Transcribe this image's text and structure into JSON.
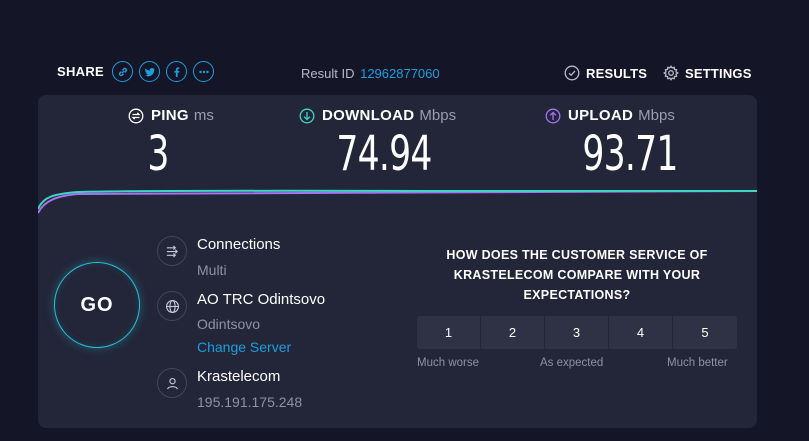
{
  "share": {
    "label": "SHARE",
    "buttons": [
      "link-icon",
      "twitter-icon",
      "facebook-icon",
      "more-icon"
    ]
  },
  "result": {
    "label": "Result ID",
    "id": "12962877060"
  },
  "nav": {
    "results": "RESULTS",
    "settings": "SETTINGS"
  },
  "metrics": {
    "ping": {
      "name": "PING",
      "unit": "ms",
      "value": "3"
    },
    "download": {
      "name": "DOWNLOAD",
      "unit": "Mbps",
      "value": "74.94"
    },
    "upload": {
      "name": "UPLOAD",
      "unit": "Mbps",
      "value": "93.71"
    }
  },
  "go_label": "GO",
  "connections": {
    "title": "Connections",
    "value": "Multi"
  },
  "server": {
    "name": "AO TRC Odintsovo",
    "location": "Odintsovo",
    "change": "Change Server"
  },
  "provider": {
    "name": "Krastelecom",
    "ip": "195.191.175.248"
  },
  "survey": {
    "question": "HOW DOES THE CUSTOMER SERVICE OF KRASTELECOM COMPARE WITH YOUR EXPECTATIONS?",
    "options": [
      "1",
      "2",
      "3",
      "4",
      "5"
    ],
    "low": "Much worse",
    "mid": "As expected",
    "high": "Much better"
  },
  "colors": {
    "accent": "#1c9fe0",
    "download": "#3fd4c4",
    "upload": "#a474f2",
    "background": "#141526",
    "card": "#232538"
  }
}
